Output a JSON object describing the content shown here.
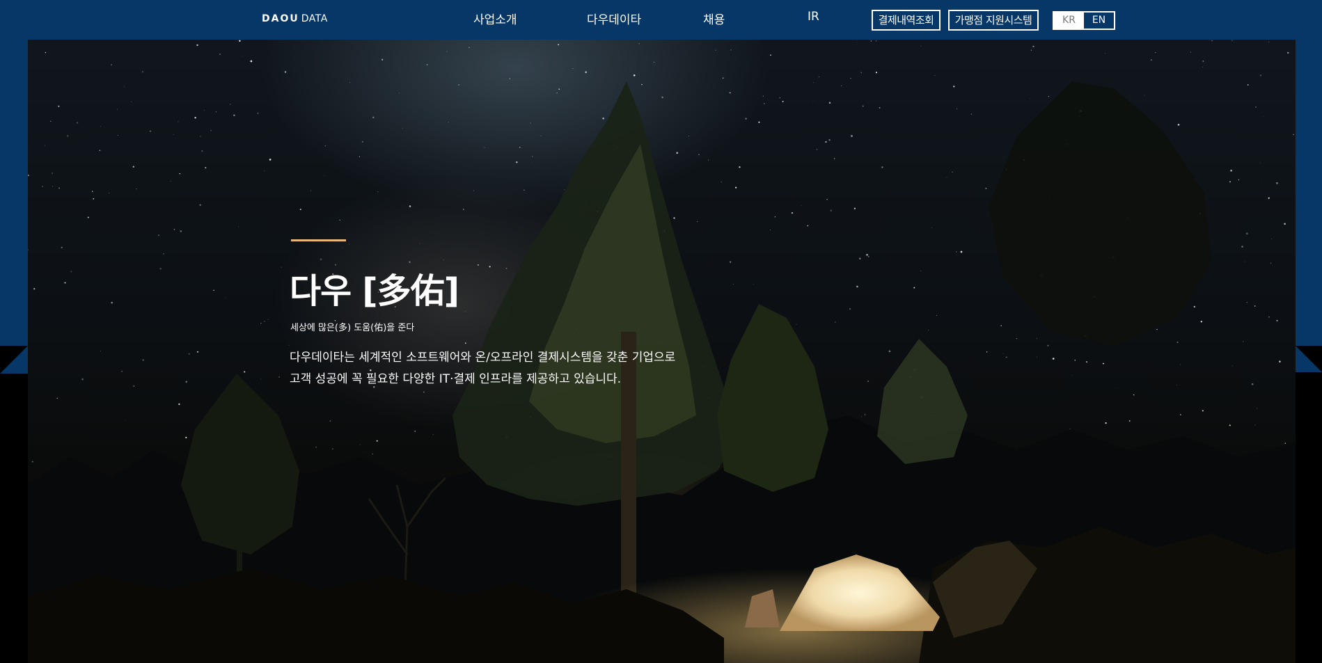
{
  "header": {
    "logo": {
      "strong": "DAOU",
      "light": "DATA"
    },
    "nav": [
      {
        "label": "사업소개"
      },
      {
        "label": "다우데이타"
      },
      {
        "label": "채용"
      },
      {
        "label": "IR"
      }
    ],
    "utility": {
      "payment_lookup": "결제내역조회",
      "merchant_system": "가맹점 지원시스템"
    },
    "language": {
      "kr": "KR",
      "en": "EN",
      "selected": "KR"
    }
  },
  "hero": {
    "title": "다우 [多佑]",
    "subtitle": "세상에 많은(多) 도움(佑)을 준다",
    "description": [
      "다우데이타는 세계적인 소프트웨어와 온/오프라인 결제시스템을 갖춘 기업으로",
      "고객 성공에 꼭 필요한 다양한 IT·결제 인프라를 제공하고 있습니다."
    ],
    "background_image": "night-sky-forest-tent"
  },
  "colors": {
    "brand_navy": "#063767",
    "accent_gold": "#e9b777"
  }
}
